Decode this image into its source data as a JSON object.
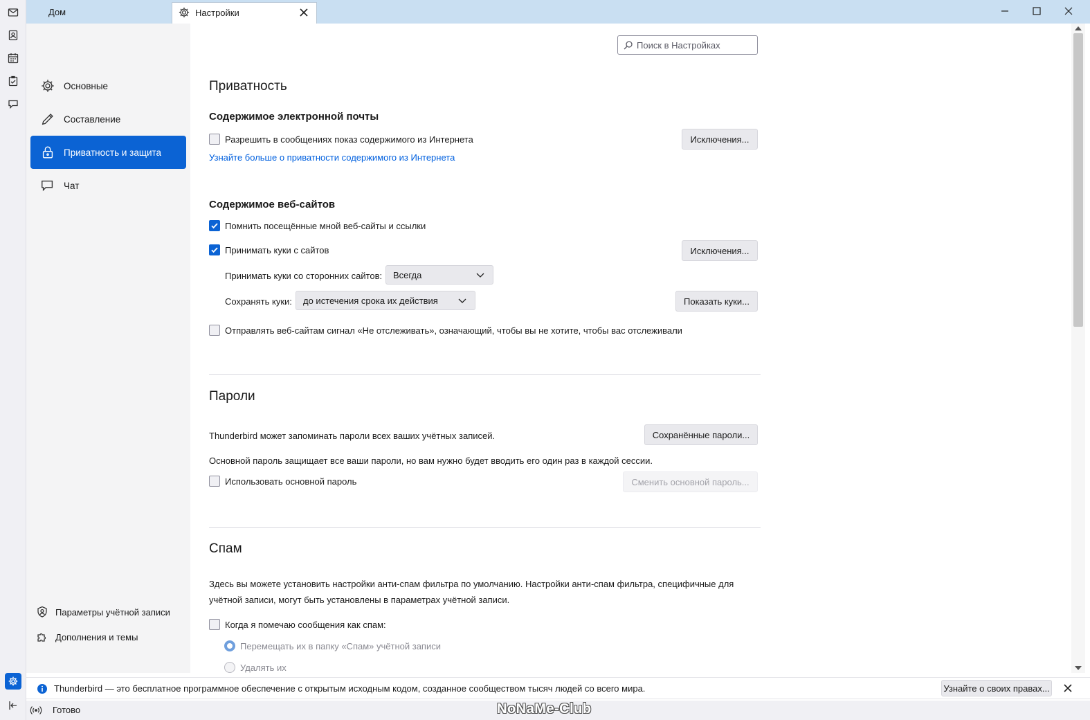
{
  "tabs": {
    "home": "Дом",
    "settings": "Настройки"
  },
  "search": {
    "placeholder": "Поиск в Настройках"
  },
  "sidebar": {
    "categories": [
      {
        "label": "Основные",
        "icon": "gear-icon"
      },
      {
        "label": "Составление",
        "icon": "pencil-icon"
      },
      {
        "label": "Приватность и защита",
        "icon": "lock-icon",
        "active": true
      },
      {
        "label": "Чат",
        "icon": "chat-icon"
      }
    ],
    "account_settings": "Параметры учётной записи",
    "addons": "Дополнения и темы"
  },
  "privacy": {
    "title": "Приватность",
    "mail_content": {
      "heading": "Содержимое электронной почты",
      "allow_remote": "Разрешить в сообщениях показ содержимого из Интернета",
      "allow_remote_checked": false,
      "exceptions": "Исключения...",
      "learn_more": "Узнайте больше о приватности содержимого из Интернета"
    },
    "web_content": {
      "heading": "Содержимое веб-сайтов",
      "remember_sites": "Помнить посещённые мной веб-сайты и ссылки",
      "remember_sites_checked": true,
      "accept_cookies": "Принимать куки с сайтов",
      "accept_cookies_checked": true,
      "exceptions": "Исключения...",
      "third_party_label": "Принимать куки со сторонних сайтов:",
      "third_party_value": "Всегда",
      "keep_label": "Сохранять куки:",
      "keep_value": "до истечения срока их действия",
      "show_cookies": "Показать куки...",
      "dnt": "Отправлять веб-сайтам сигнал «Не отслеживать», означающий, чтобы вы не хотите, чтобы вас отслеживали",
      "dnt_checked": false
    }
  },
  "passwords": {
    "title": "Пароли",
    "remember_text": "Thunderbird может запоминать пароли всех ваших учётных записей.",
    "saved_passwords": "Сохранённые пароли...",
    "primary_text": "Основной пароль защищает все ваши пароли, но вам нужно будет вводить его один раз в каждой сессии.",
    "use_primary": "Использовать основной пароль",
    "use_primary_checked": false,
    "change_primary": "Сменить основной пароль..."
  },
  "spam": {
    "title": "Спам",
    "description": "Здесь вы можете установить настройки анти-спам фильтра по умолчанию. Настройки анти-спам фильтра, специфичные для учётной записи, могут быть установлены в параметрах учётной записи.",
    "mark_as_spam": "Когда я помечаю сообщения как спам:",
    "mark_as_spam_checked": false,
    "move_to_folder": "Перемещать их в папку «Спам» учётной записи",
    "delete": "Удалять их"
  },
  "notification": {
    "text": "Thunderbird — это бесплатное программное обеспечение с открытым исходным кодом, созданное сообществом тысяч людей со всего мира.",
    "button": "Узнайте о своих правах..."
  },
  "status": {
    "text": "Готово",
    "watermark": "NoNaMe-Club"
  },
  "colors": {
    "accent": "#0b63d4",
    "link": "#0060df",
    "tabbar": "#c9dff2"
  }
}
